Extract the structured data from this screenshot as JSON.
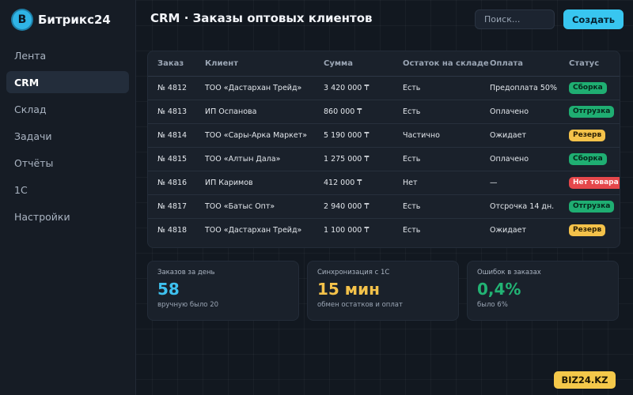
{
  "app": {
    "logo_letter": "B",
    "name": "Битрикс24"
  },
  "nav": [
    {
      "label": "Лента",
      "active": false
    },
    {
      "label": "CRM",
      "active": true
    },
    {
      "label": "Склад",
      "active": false
    },
    {
      "label": "Задачи",
      "active": false
    },
    {
      "label": "Отчёты",
      "active": false
    },
    {
      "label": "1С",
      "active": false
    },
    {
      "label": "Настройки",
      "active": false
    }
  ],
  "header": {
    "title": "CRM · Заказы оптовых клиентов",
    "search_placeholder": "Поиск...",
    "create_label": "Создать"
  },
  "orders": {
    "columns": [
      "Заказ",
      "Клиент",
      "Сумма",
      "Остаток на складе",
      "Оплата",
      "Статус"
    ],
    "rows": [
      {
        "id": "№ 4812",
        "client": "ТОО «Дастархан Трейд»",
        "sum": "3 420 000 ₸",
        "stock": "Есть",
        "payment": "Предоплата 50%",
        "status": "Сборка",
        "status_tone": "green"
      },
      {
        "id": "№ 4813",
        "client": "ИП Оспанова",
        "sum": "860 000 ₸",
        "stock": "Есть",
        "payment": "Оплачено",
        "status": "Отгрузка",
        "status_tone": "green"
      },
      {
        "id": "№ 4814",
        "client": "ТОО «Сары-Арка Маркет»",
        "sum": "5 190 000 ₸",
        "stock": "Частично",
        "payment": "Ожидает",
        "status": "Резерв",
        "status_tone": "yellow"
      },
      {
        "id": "№ 4815",
        "client": "ТОО «Алтын Дала»",
        "sum": "1 275 000 ₸",
        "stock": "Есть",
        "payment": "Оплачено",
        "status": "Сборка",
        "status_tone": "green"
      },
      {
        "id": "№ 4816",
        "client": "ИП Каримов",
        "sum": "412 000 ₸",
        "stock": "Нет",
        "payment": "—",
        "status": "Нет товара",
        "status_tone": "red"
      },
      {
        "id": "№ 4817",
        "client": "ТОО «Батыс Опт»",
        "sum": "2 940 000 ₸",
        "stock": "Есть",
        "payment": "Отсрочка 14 дн.",
        "status": "Отгрузка",
        "status_tone": "green"
      },
      {
        "id": "№ 4818",
        "client": "ТОО «Дастархан Трейд»",
        "sum": "1 100 000 ₸",
        "stock": "Есть",
        "payment": "Ожидает",
        "status": "Резерв",
        "status_tone": "yellow"
      }
    ]
  },
  "stats": [
    {
      "label": "Заказов за день",
      "value": "58",
      "sub": "вручную было 20",
      "color": "#3ec1ef"
    },
    {
      "label": "Синхронизация с 1С",
      "value": "15 мин",
      "sub": "обмен остатков и оплат",
      "color": "#f4c24a"
    },
    {
      "label": "Ошибок в заказах",
      "value": "0,4%",
      "sub": "было 6%",
      "color": "#22b374"
    }
  ],
  "watermark": "BIZ24.KZ"
}
